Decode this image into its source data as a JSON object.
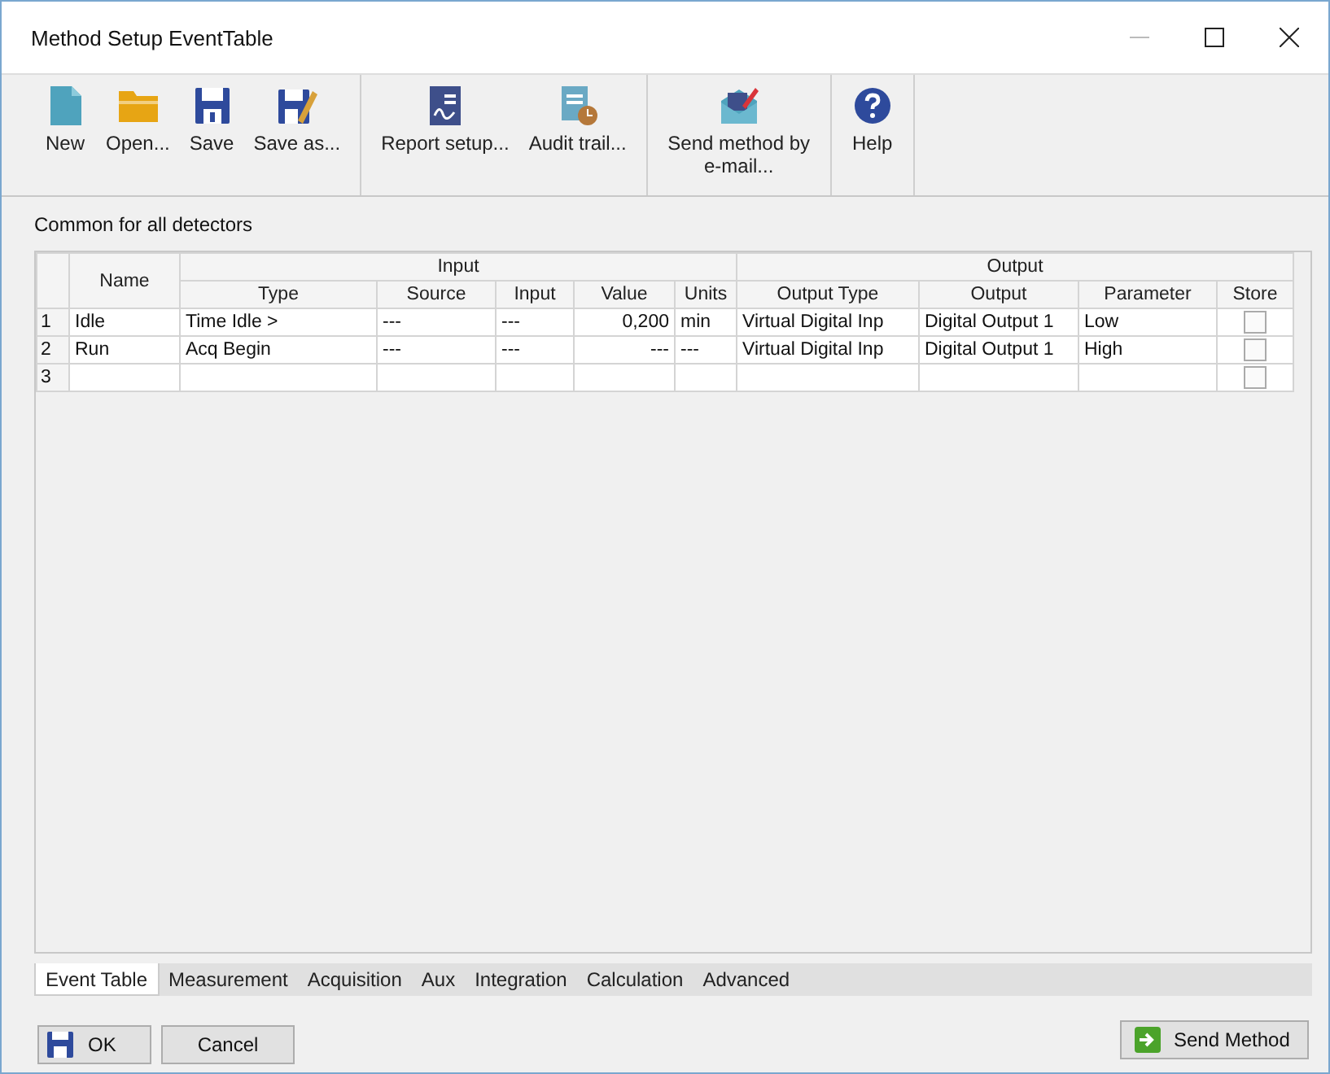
{
  "window": {
    "title": "Method Setup EventTable"
  },
  "toolbar": [
    [
      {
        "label": "New"
      },
      {
        "label": "Open..."
      },
      {
        "label": "Save"
      },
      {
        "label": "Save as..."
      }
    ],
    [
      {
        "label": "Report setup..."
      },
      {
        "label": "Audit trail..."
      }
    ],
    [
      {
        "label": "Send method by e-mail..."
      }
    ],
    [
      {
        "label": "Help"
      }
    ]
  ],
  "section_label": "Common for all detectors",
  "table": {
    "group_headers": [
      "Input",
      "Output"
    ],
    "columns": [
      "Name",
      "Type",
      "Source",
      "Input",
      "Value",
      "Units",
      "Output Type",
      "Output",
      "Parameter",
      "Store"
    ],
    "rows": [
      {
        "number": "1",
        "name": "Idle",
        "type": "Time Idle >",
        "source": "---",
        "input": "---",
        "value": "0,200",
        "units": "min",
        "output_type": "Virtual Digital Inp",
        "output": "Digital Output 1",
        "parameter": "Low",
        "store": false
      },
      {
        "number": "2",
        "name": "Run",
        "type": "Acq Begin",
        "source": "---",
        "input": "---",
        "value": "---",
        "units": "---",
        "output_type": "Virtual Digital Inp",
        "output": "Digital Output 1",
        "parameter": "High",
        "store": false
      },
      {
        "number": "3",
        "store": false
      }
    ]
  },
  "tabs": [
    {
      "label": "Event Table",
      "selected": true
    },
    {
      "label": "Measurement",
      "selected": false
    },
    {
      "label": "Acquisition",
      "selected": false
    },
    {
      "label": "Aux",
      "selected": false
    },
    {
      "label": "Integration",
      "selected": false
    },
    {
      "label": "Calculation",
      "selected": false
    },
    {
      "label": "Advanced",
      "selected": false
    }
  ],
  "buttons": {
    "ok": "OK",
    "cancel": "Cancel",
    "send": "Send Method"
  }
}
